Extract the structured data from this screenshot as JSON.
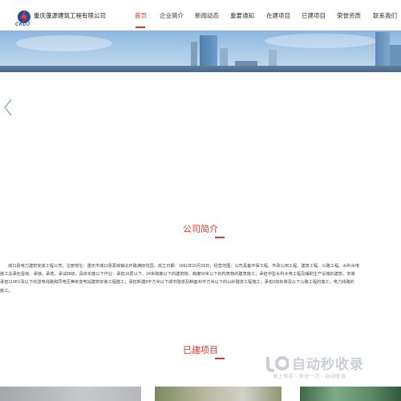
{
  "header": {
    "logo_text": "CKDJ",
    "company_name": "重庆蓬源建筑工程有限公司"
  },
  "nav": {
    "items": [
      {
        "label": "首页",
        "active": true
      },
      {
        "label": "企业简介"
      },
      {
        "label": "新闻动态"
      },
      {
        "label": "重要通知"
      },
      {
        "label": "在建项目"
      },
      {
        "label": "已建项目"
      },
      {
        "label": "荣誉资质"
      },
      {
        "label": "联系我们"
      }
    ]
  },
  "about": {
    "title": "公司简介",
    "lines": [
      "城口县电力建筑安装工程公司，注册地址：重庆市城口县葛城镇北环路满田花园，成立日期：1991年10月29日，经营范围：公司具备环保工程、市政公用工程、建筑工程、公路工程、水利水电",
      "施工总承包壹级、承接、承揽、承试四级；具体实施以下作业：承担16层以下、24米跨度以下的建筑物、高度50米以下的构筑物的建筑施工；承担中型水利水电工程及辅助生产设施的建筑、安装",
      "承担110KV及以下的送电线路和同电压等级变电站建筑安装工程施工；承担新建8平方米以下城市隧道及断面30平方米以下的山岭隧道工程施工；承担2级标准及以下公路工程的施工；电力线路的",
      "施工。"
    ]
  },
  "projects": {
    "title": "已建项目"
  },
  "watermark": {
    "main": "自动秒收录",
    "sub": "做上排名→来访一次→自动收录"
  },
  "colors": {
    "accent": "#d9372b",
    "brand_blue": "#1d4e9e"
  },
  "icons": {
    "prev": "chevron-left-icon",
    "logo": "lightning-logo-icon"
  }
}
